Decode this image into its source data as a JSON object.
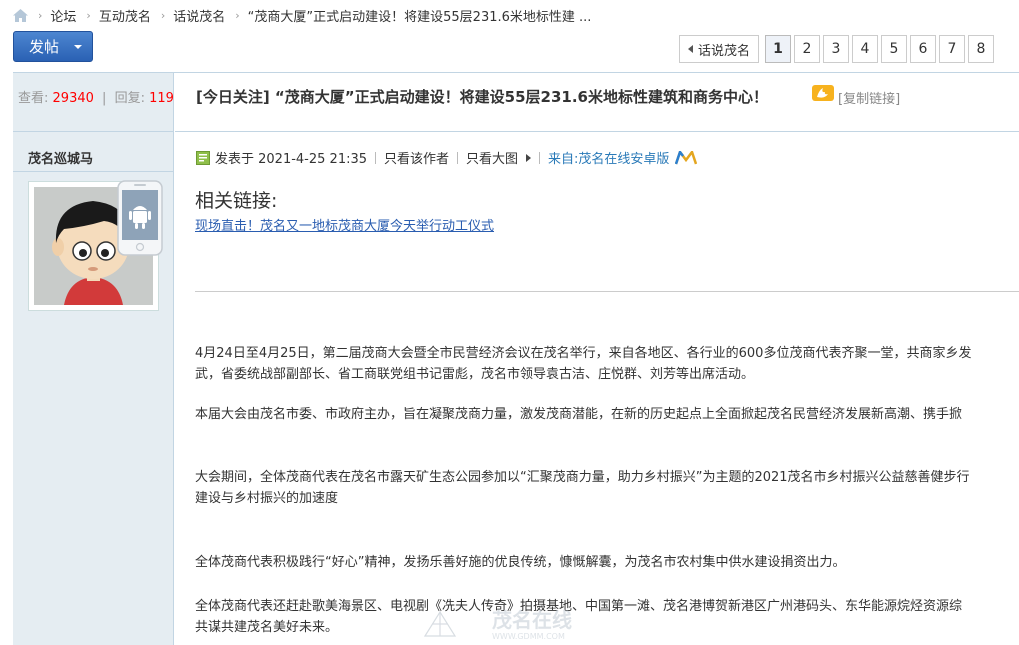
{
  "breadcrumb": {
    "items": [
      "论坛",
      "互动茂名",
      "话说茂名",
      "“茂商大厦”正式启动建设！将建设55层231.6米地标性建 ..."
    ]
  },
  "toolbar": {
    "post_label": "发帖"
  },
  "pager": {
    "back_label": "话说茂名",
    "pages": [
      "1",
      "2",
      "3",
      "4",
      "5",
      "6",
      "7",
      "8"
    ],
    "current": "1"
  },
  "thread": {
    "views_label": "查看:",
    "views": "29340",
    "replies_label": "回复:",
    "replies": "119",
    "title": "[今日关注] “茂商大厦”正式启动建设！将建设55层231.6米地标性建筑和商务中心！",
    "copy_link": "[复制链接]"
  },
  "author": {
    "name": "茂名巡城马"
  },
  "post": {
    "posted": "发表于 2021-4-25 21:35",
    "only_author": "只看该作者",
    "big_image": "只看大图",
    "source": "来自:茂名在线安卓版",
    "related_title": "相关链接:",
    "related_link": "现场直击！茂名又一地标茂商大厦今天举行动工仪式",
    "paragraphs": [
      "4月24日至4月25日，第二届茂商大会暨全市民营经济会议在茂名举行，来自各地区、各行业的600多位茂商代表齐聚一堂，共商家乡发",
      "武，省委统战部副部长、省工商联党组书记雷彪，茂名市领导袁古洁、庄悦群、刘芳等出席活动。",
      "本届大会由茂名市委、市政府主办，旨在凝聚茂商力量，激发茂商潜能，在新的历史起点上全面掀起茂名民营经济发展新高潮、携手掀",
      "大会期间，全体茂商代表在茂名市露天矿生态公园参加以“汇聚茂商力量，助力乡村振兴”为主题的2021茂名市乡村振兴公益慈善健步行",
      "建设与乡村振兴的加速度",
      "全体茂商代表积极践行“好心”精神，发扬乐善好施的优良传统，慷慨解囊，为茂名市农村集中供水建设捐资出力。",
      "全体茂商代表还赶赴歌美海景区、电视剧《冼夫人传奇》拍摄基地、中国第一滩、茂名港博贺新港区广州港码头、东华能源烷烃资源综",
      "共谋共建茂名美好未来。"
    ]
  },
  "watermark": {
    "text": "茂名在线",
    "url": "WWW.GDMM.COM"
  },
  "colors": {
    "accent": "#2a61b4",
    "link": "#2a5db0",
    "stat_number": "#ff0000",
    "left_column_bg": "#e5edf2"
  }
}
